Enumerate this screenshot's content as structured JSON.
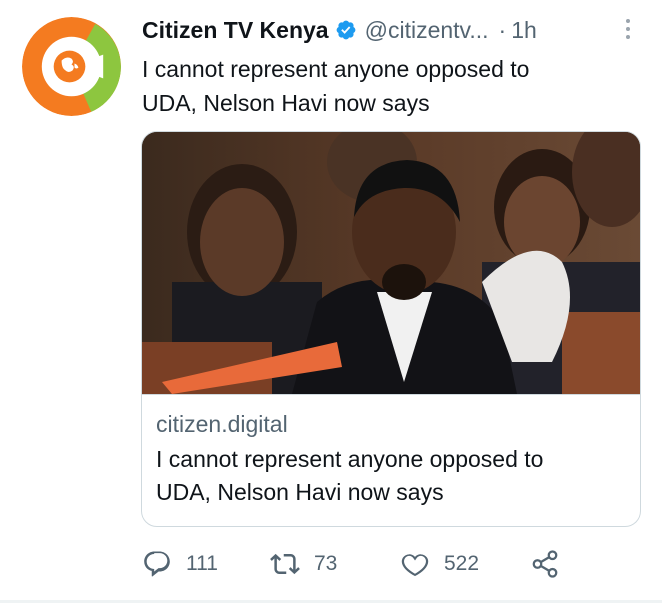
{
  "tweet": {
    "author_name": "Citizen TV Kenya",
    "handle": "@citizentv...",
    "separator": "·",
    "time": "1h",
    "text_line1": "I cannot represent anyone opposed to",
    "text_line2": "UDA, Nelson Havi now says"
  },
  "card": {
    "domain": "citizen.digital",
    "title_line1": "I cannot represent anyone opposed to",
    "title_line2": "UDA, Nelson Havi now says"
  },
  "actions": {
    "replies": "111",
    "retweets": "73",
    "likes": "522"
  },
  "icons": {
    "avatar": "citizen-tv-logo",
    "verified": "verified-badge-icon",
    "more": "more-vertical-icon",
    "reply": "reply-icon",
    "retweet": "retweet-icon",
    "like": "heart-icon",
    "share": "share-icon"
  },
  "colors": {
    "brand_orange": "#f47b20",
    "brand_green": "#8dc63f",
    "verified_blue": "#1d9bf0",
    "text_primary": "#0f1419",
    "text_secondary": "#536471",
    "border": "#cfd9de"
  }
}
